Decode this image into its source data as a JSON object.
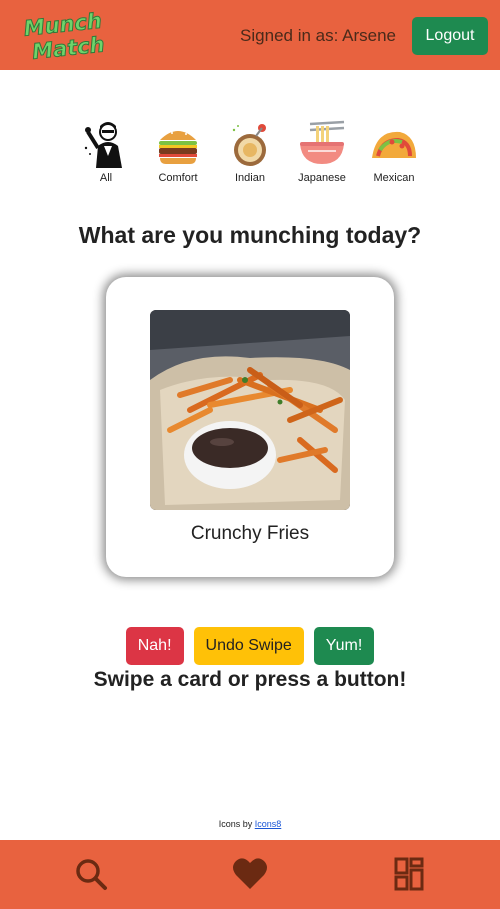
{
  "header": {
    "logo_text_line1": "Munch",
    "logo_text_line2": "Match",
    "signed_in_text": "Signed in as: Arsene",
    "logout_label": "Logout"
  },
  "categories": [
    {
      "label": "All",
      "icon": "man-cheering-icon"
    },
    {
      "label": "Comfort",
      "icon": "burger-icon"
    },
    {
      "label": "Indian",
      "icon": "curry-bowl-icon"
    },
    {
      "label": "Japanese",
      "icon": "ramen-bowl-icon"
    },
    {
      "label": "Mexican",
      "icon": "taco-icon"
    }
  ],
  "main": {
    "question": "What are you munching today?",
    "card": {
      "title": "Crunchy Fries",
      "image": "fries-with-dip-photo"
    },
    "buttons": {
      "nah": "Nah!",
      "undo": "Undo Swipe",
      "yum": "Yum!"
    },
    "hint": "Swipe a card or press a button!"
  },
  "footer": {
    "credit_prefix": "Icons by",
    "credit_link": "Icons8"
  },
  "bottom_nav": [
    {
      "icon": "search-icon"
    },
    {
      "icon": "heart-icon"
    },
    {
      "icon": "dashboard-icon"
    }
  ],
  "colors": {
    "brand": "#e8623f",
    "success": "#1e8a50",
    "danger": "#dc3545",
    "warning": "#ffc107",
    "nav_icon": "#6b2a12"
  }
}
